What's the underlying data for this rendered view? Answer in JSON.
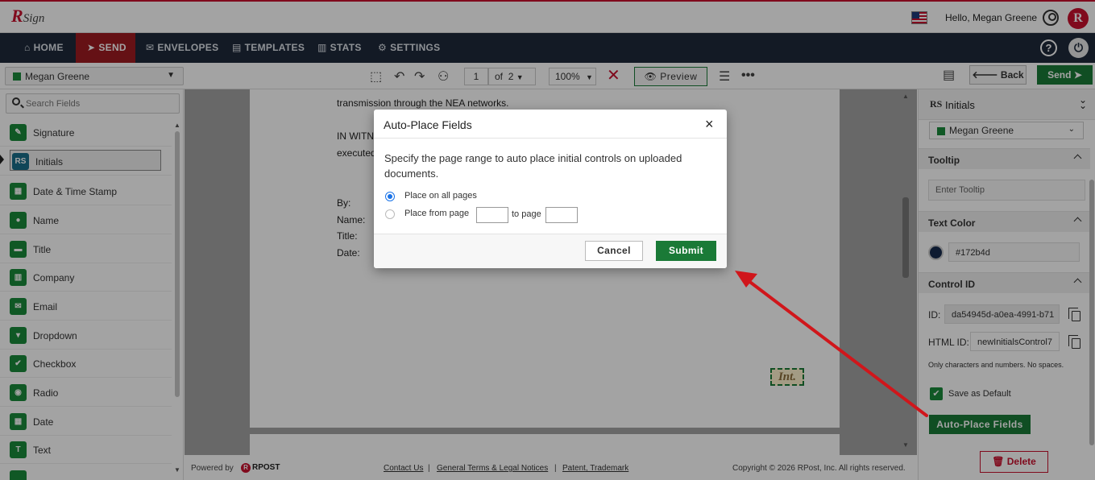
{
  "header": {
    "logo_r": "R",
    "logo_sign": "Sign",
    "greeting": "Hello, Megan Greene",
    "badge": "R",
    "flag_icon": "us-flag-icon"
  },
  "nav": {
    "items": [
      {
        "label": "HOME",
        "icon": "⌂"
      },
      {
        "label": "SEND",
        "icon": "➤"
      },
      {
        "label": "ENVELOPES",
        "icon": "✉"
      },
      {
        "label": "TEMPLATES",
        "icon": "▤"
      },
      {
        "label": "STATS",
        "icon": "▥"
      },
      {
        "label": "SETTINGS",
        "icon": "⚙"
      }
    ],
    "active": "SEND",
    "help": "?",
    "power": "⏻"
  },
  "toolbar": {
    "signer": "Megan Greene",
    "page_current": "1",
    "page_of": "of",
    "page_total": "2",
    "zoom": "100%",
    "preview": "Preview",
    "back": "Back",
    "send": "Send"
  },
  "left_panel": {
    "search_placeholder": "Search Fields",
    "fields": [
      {
        "label": "Signature",
        "icon": "✎"
      },
      {
        "label": "Initials",
        "icon": "RS"
      },
      {
        "label": "Date & Time Stamp",
        "icon": "▦"
      },
      {
        "label": "Name",
        "icon": "●"
      },
      {
        "label": "Title",
        "icon": "▬"
      },
      {
        "label": "Company",
        "icon": "▥"
      },
      {
        "label": "Email",
        "icon": "✉"
      },
      {
        "label": "Dropdown",
        "icon": "▾"
      },
      {
        "label": "Checkbox",
        "icon": "✔"
      },
      {
        "label": "Radio",
        "icon": "◉"
      },
      {
        "label": "Date",
        "icon": "▦"
      },
      {
        "label": "Text",
        "icon": "T"
      }
    ],
    "active_field": "Initials"
  },
  "document": {
    "line1": "transmission through the NEA networks.",
    "line2": "IN WITN",
    "line3": "executed",
    "by": "By:",
    "name": "Name:",
    "title": "Title:",
    "date": "Date:",
    "initials_placeholder": "Int."
  },
  "footer": {
    "powered_by": "Powered by",
    "rpost_logo": "RPOST",
    "contact": "Contact Us",
    "terms": "General Terms & Legal Notices",
    "patent": "Patent, Trademark",
    "sep": "|",
    "copyright": "Copyright © 2026 RPost, Inc. All rights reserved."
  },
  "right_panel": {
    "icon": "RS",
    "title": "Initials",
    "signer": "Megan Greene",
    "tooltip_section": "Tooltip",
    "tooltip_placeholder": "Enter Tooltip",
    "color_section": "Text Color",
    "color_value": "#172b4d",
    "control_section": "Control ID",
    "id_label": "ID:",
    "id_value": "da54945d-a0ea-4991-b71",
    "html_id_label": "HTML ID:",
    "html_id_value": "newInitialsControl7",
    "hint": "Only characters and numbers. No spaces.",
    "save_default": "Save as Default",
    "autoplace": "Auto-Place Fields",
    "delete": "Delete"
  },
  "modal": {
    "title": "Auto-Place Fields",
    "close": "×",
    "description": "Specify the page range to auto place initial controls on uploaded documents.",
    "option_all": "Place on all pages",
    "option_range": "Place from page",
    "to_page": "to page",
    "from_value": "",
    "to_value": "",
    "selected": "all",
    "cancel": "Cancel",
    "submit": "Submit"
  },
  "colors": {
    "brand_red": "#c8102e",
    "nav_bg": "#1e2a3b",
    "accent_green": "#1a7a37",
    "arrow_red": "#d0161b"
  }
}
